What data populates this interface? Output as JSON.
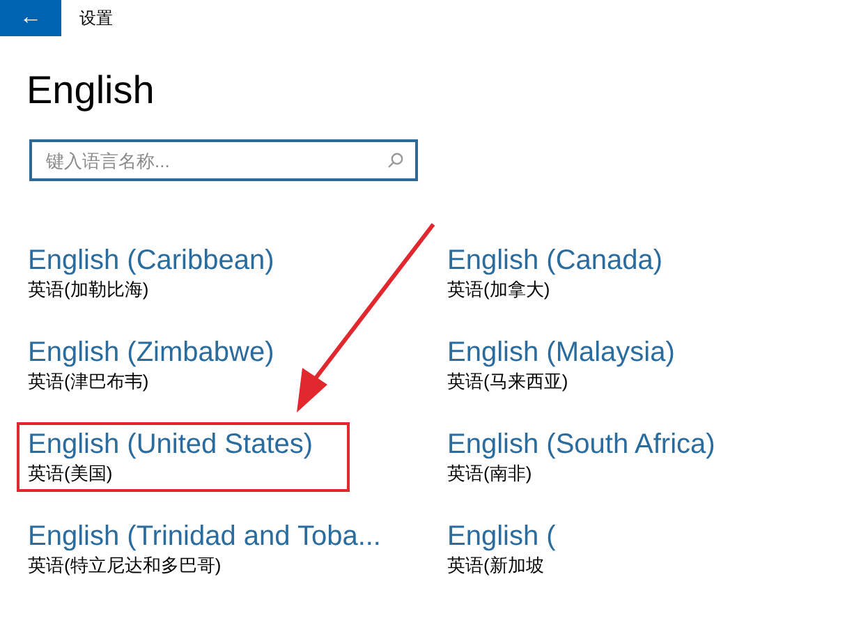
{
  "header": {
    "back": "←",
    "title": "设置"
  },
  "page_title": "English",
  "search": {
    "placeholder": "键入语言名称..."
  },
  "languages": [
    {
      "name": "English (Caribbean)",
      "native": "英语(加勒比海)",
      "highlighted": false
    },
    {
      "name": "English (Canada)",
      "native": "英语(加拿大)",
      "highlighted": false
    },
    {
      "name": "English (Zimbabwe)",
      "native": "英语(津巴布韦)",
      "highlighted": false
    },
    {
      "name": "English (Malaysia)",
      "native": "英语(马来西亚)",
      "highlighted": false
    },
    {
      "name": "English (United States)",
      "native": "英语(美国)",
      "highlighted": true
    },
    {
      "name": "English (South Africa)",
      "native": "英语(南非)",
      "highlighted": false
    },
    {
      "name": "English (Trinidad and Toba...",
      "native": "英语(特立尼达和多巴哥)",
      "highlighted": false
    },
    {
      "name": "English (",
      "native": "英语(新加坡",
      "highlighted": false
    }
  ]
}
